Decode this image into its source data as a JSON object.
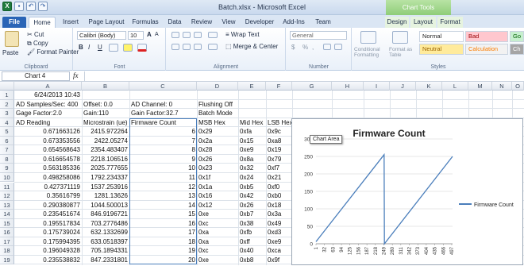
{
  "window": {
    "title": "Batch.xlsx - Microsoft Excel",
    "context_tools": "Chart Tools"
  },
  "tabs": [
    "File",
    "Home",
    "Insert",
    "Page Layout",
    "Formulas",
    "Data",
    "Review",
    "View",
    "Developer",
    "Add-Ins",
    "Team",
    "Design",
    "Layout",
    "Format"
  ],
  "ribbon": {
    "clipboard": {
      "label": "Clipboard",
      "paste": "Paste",
      "cut": "Cut",
      "copy": "Copy",
      "format_painter": "Format Painter"
    },
    "font": {
      "label": "Font",
      "family": "Calibri (Body)",
      "size": "10",
      "bold": "B",
      "italic": "I",
      "underline": "U",
      "grow": "A",
      "shrink": "A"
    },
    "alignment": {
      "label": "Alignment",
      "wrap": "Wrap Text",
      "merge": "Merge & Center"
    },
    "number": {
      "label": "Number",
      "format": "General",
      "currency": "$",
      "percent": "%",
      "comma": ","
    },
    "styles": {
      "label": "Styles",
      "conditional": "Conditional Formatting",
      "format_table": "Format as Table",
      "normal": "Normal",
      "bad": "Bad",
      "good": "Go",
      "neutral": "Neutral",
      "calculation": "Calculation",
      "check": "Ch"
    }
  },
  "formula_bar": {
    "name_box": "Chart 4",
    "fx": "fx",
    "value": ""
  },
  "columns": [
    "A",
    "B",
    "C",
    "D",
    "E",
    "F",
    "G",
    "H",
    "I",
    "J",
    "K",
    "L",
    "M",
    "N",
    "O"
  ],
  "rows": [
    [
      "1",
      "6/24/2013 10:43",
      "",
      "",
      "",
      "",
      ""
    ],
    [
      "2",
      "AD Samples/Sec: 400",
      "Offset: 0.0",
      "AD Channel: 0",
      "Flushing Off",
      "",
      ""
    ],
    [
      "3",
      "Gage Factor:2.0",
      "Gain:110",
      "Gain Factor:32.7",
      "Batch Mode",
      "",
      ""
    ],
    [
      "4",
      "AD Reading",
      "Microstrain (ue)",
      "Firmware Count",
      "MSB Hex",
      "Mid Hex",
      "LSB Hex"
    ],
    [
      "5",
      "0.671663126",
      "2415.972264",
      "6",
      "0x29",
      "0xfa",
      "0x9c"
    ],
    [
      "6",
      "0.673353556",
      "2422.05274",
      "7",
      "0x2a",
      "0x15",
      "0xa8"
    ],
    [
      "7",
      "0.654568643",
      "2354.483407",
      "8",
      "0x28",
      "0xe9",
      "0x19"
    ],
    [
      "8",
      "0.616654578",
      "2218.106516",
      "9",
      "0x26",
      "0x8a",
      "0x79"
    ],
    [
      "9",
      "0.563185336",
      "2025.777655",
      "10",
      "0x23",
      "0x32",
      "0xf7"
    ],
    [
      "10",
      "0.498258086",
      "1792.234337",
      "11",
      "0x1f",
      "0x24",
      "0x21"
    ],
    [
      "11",
      "0.427371119",
      "1537.253916",
      "12",
      "0x1a",
      "0xb5",
      "0xf0"
    ],
    [
      "12",
      "0.35616799",
      "1281.13626",
      "13",
      "0x16",
      "0x42",
      "0xb0"
    ],
    [
      "13",
      "0.290380877",
      "1044.500013",
      "14",
      "0x12",
      "0x26",
      "0x18"
    ],
    [
      "14",
      "0.235451674",
      "846.9196721",
      "15",
      "0xe",
      "0xb7",
      "0x3a"
    ],
    [
      "15",
      "0.195517834",
      "703.2776486",
      "16",
      "0xc",
      "0x38",
      "0x49"
    ],
    [
      "16",
      "0.175739024",
      "632.1332699",
      "17",
      "0xa",
      "0xfb",
      "0xd3"
    ],
    [
      "17",
      "0.175994395",
      "633.0518397",
      "18",
      "0xa",
      "0xff",
      "0xe9"
    ],
    [
      "18",
      "0.196049328",
      "705.1894331",
      "19",
      "0xc",
      "0x40",
      "0xca"
    ],
    [
      "19",
      "0.235538832",
      "847.2331801",
      "20",
      "0xe",
      "0xb8",
      "0x9f"
    ]
  ],
  "chart_tooltip": "Chart Area",
  "chart_data": {
    "type": "line",
    "title": "Firmware Count",
    "series": [
      {
        "name": "Firmware Count",
        "x": [
          1,
          32,
          63,
          94,
          125,
          156,
          187,
          218,
          249,
          280,
          311,
          342,
          373,
          404,
          435,
          466,
          497
        ],
        "points": [
          [
            1,
            6
          ],
          [
            250,
            255
          ],
          [
            251,
            0
          ],
          [
            500,
            250
          ]
        ]
      }
    ],
    "xticks": [
      "1",
      "32",
      "63",
      "94",
      "125",
      "156",
      "187",
      "218",
      "249",
      "280",
      "311",
      "342",
      "373",
      "404",
      "435",
      "466",
      "497"
    ],
    "yticks": [
      0,
      50,
      100,
      150,
      200,
      250,
      300
    ],
    "ylim": [
      0,
      300
    ],
    "legend": "right",
    "grid": true
  }
}
